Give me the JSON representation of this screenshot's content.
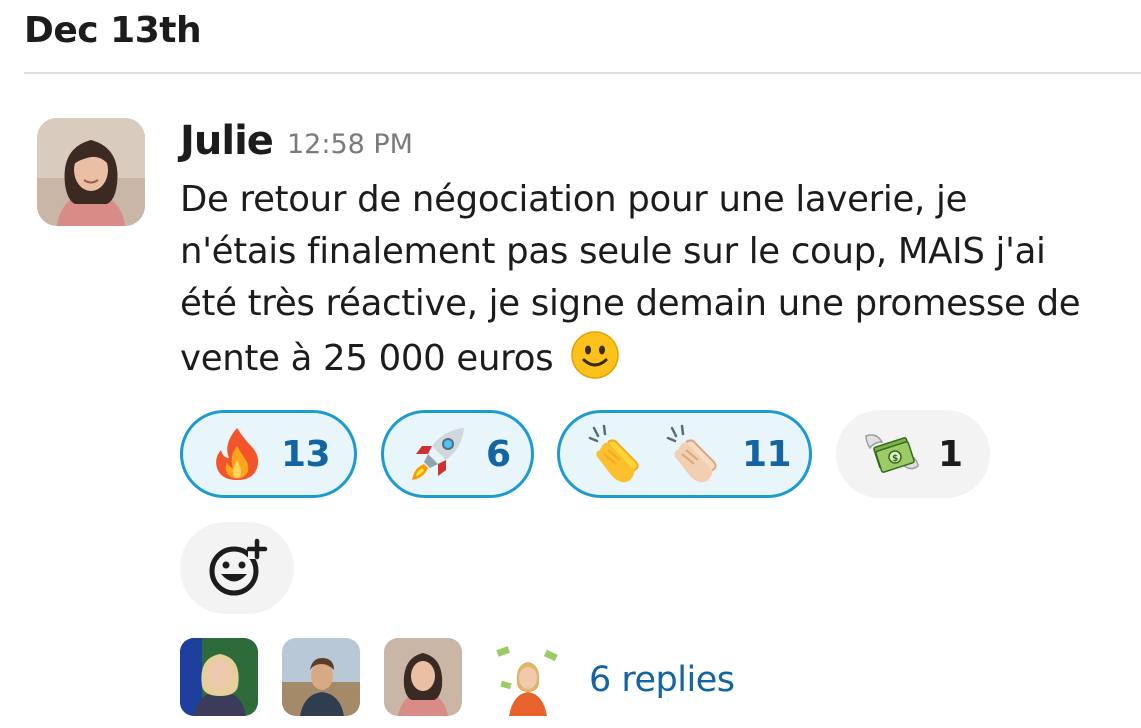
{
  "date_divider": {
    "label": "Dec 13th"
  },
  "message": {
    "sender": "Julie",
    "time": "12:58 PM",
    "text": "De retour de négociation pour une laverie, je n'étais finalement pas seule sur le coup, MAIS j'ai été très réactive, je signe demain une promesse de vente à 25 000 euros",
    "trailing_emoji": "slightly-smiling-face"
  },
  "reactions": [
    {
      "emoji": "fire",
      "count": "13",
      "reacted_by_me": true
    },
    {
      "emoji": "rocket",
      "count": "6",
      "reacted_by_me": true
    },
    {
      "emoji": "clap, clap-light-skin-tone",
      "count": "11",
      "reacted_by_me": true
    },
    {
      "emoji": "money-with-wings",
      "count": "1",
      "reacted_by_me": false
    }
  ],
  "add_reaction": {
    "icon": "add-emoji-icon"
  },
  "thread": {
    "reply_count_label": "6 replies"
  },
  "colors": {
    "active_border": "#1d9bd1",
    "active_bg": "#e8f5fa",
    "link": "#1264a3",
    "muted": "#7b7a7b"
  }
}
